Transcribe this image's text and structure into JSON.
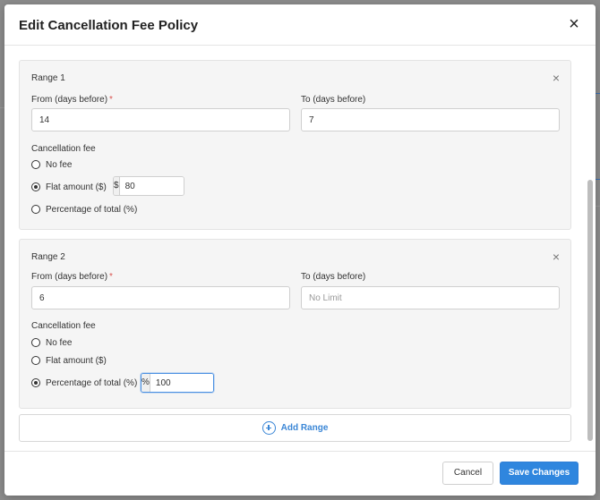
{
  "modal": {
    "title": "Edit Cancellation Fee Policy",
    "close_glyph": "×"
  },
  "ranges": [
    {
      "title": "Range 1",
      "remove_glyph": "×",
      "from_label": "From (days before)",
      "required_mark": "*",
      "from_value": "14",
      "to_label": "To (days before)",
      "to_value": "7",
      "to_placeholder": "",
      "fee_label": "Cancellation fee",
      "options": [
        "No fee",
        "Flat amount ($)",
        "Percentage of total (%)"
      ],
      "selected_option": "Flat amount ($)",
      "amount_prefix": "$",
      "amount_value": "80"
    },
    {
      "title": "Range 2",
      "remove_glyph": "×",
      "from_label": "From (days before)",
      "required_mark": "*",
      "from_value": "6",
      "to_label": "To (days before)",
      "to_value": "",
      "to_placeholder": "No Limit",
      "fee_label": "Cancellation fee",
      "options": [
        "No fee",
        "Flat amount ($)",
        "Percentage of total (%)"
      ],
      "selected_option": "Percentage of total (%)",
      "amount_prefix": "%",
      "amount_value": "100"
    }
  ],
  "add_range_label": "Add Range",
  "footer": {
    "cancel_label": "Cancel",
    "save_label": "Save Changes"
  },
  "colors": {
    "accent": "#2f86de",
    "required": "#d9534f",
    "card_bg": "#f5f5f5"
  }
}
